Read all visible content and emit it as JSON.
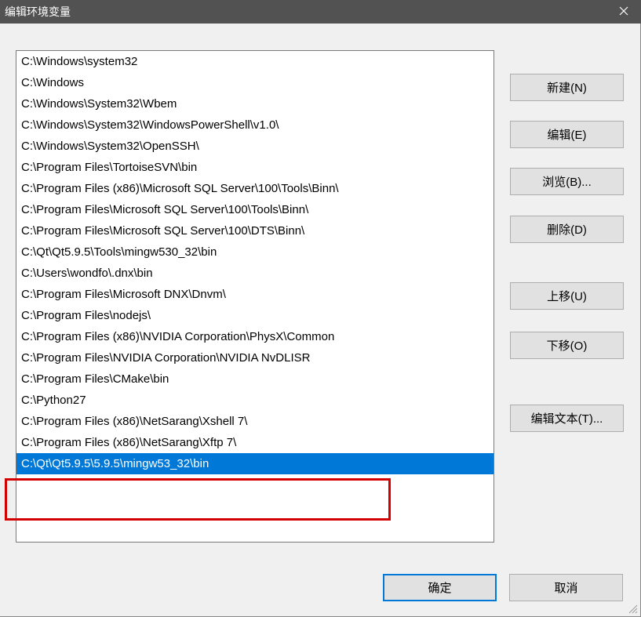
{
  "window": {
    "title": "编辑环境变量"
  },
  "list": {
    "items": [
      "C:\\Windows\\system32",
      "C:\\Windows",
      "C:\\Windows\\System32\\Wbem",
      "C:\\Windows\\System32\\WindowsPowerShell\\v1.0\\",
      "C:\\Windows\\System32\\OpenSSH\\",
      "C:\\Program Files\\TortoiseSVN\\bin",
      "C:\\Program Files (x86)\\Microsoft SQL Server\\100\\Tools\\Binn\\",
      "C:\\Program Files\\Microsoft SQL Server\\100\\Tools\\Binn\\",
      "C:\\Program Files\\Microsoft SQL Server\\100\\DTS\\Binn\\",
      "C:\\Qt\\Qt5.9.5\\Tools\\mingw530_32\\bin",
      "C:\\Users\\wondfo\\.dnx\\bin",
      "C:\\Program Files\\Microsoft DNX\\Dnvm\\",
      "C:\\Program Files\\nodejs\\",
      "C:\\Program Files (x86)\\NVIDIA Corporation\\PhysX\\Common",
      "C:\\Program Files\\NVIDIA Corporation\\NVIDIA NvDLISR",
      "C:\\Program Files\\CMake\\bin",
      "C:\\Python27",
      "C:\\Program Files (x86)\\NetSarang\\Xshell 7\\",
      "C:\\Program Files (x86)\\NetSarang\\Xftp 7\\",
      "C:\\Qt\\Qt5.9.5\\5.9.5\\mingw53_32\\bin"
    ],
    "selected_index": 19
  },
  "buttons": {
    "new": "新建(N)",
    "edit": "编辑(E)",
    "browse": "浏览(B)...",
    "delete": "删除(D)",
    "move_up": "上移(U)",
    "move_down": "下移(O)",
    "edit_text": "编辑文本(T)...",
    "ok": "确定",
    "cancel": "取消"
  }
}
